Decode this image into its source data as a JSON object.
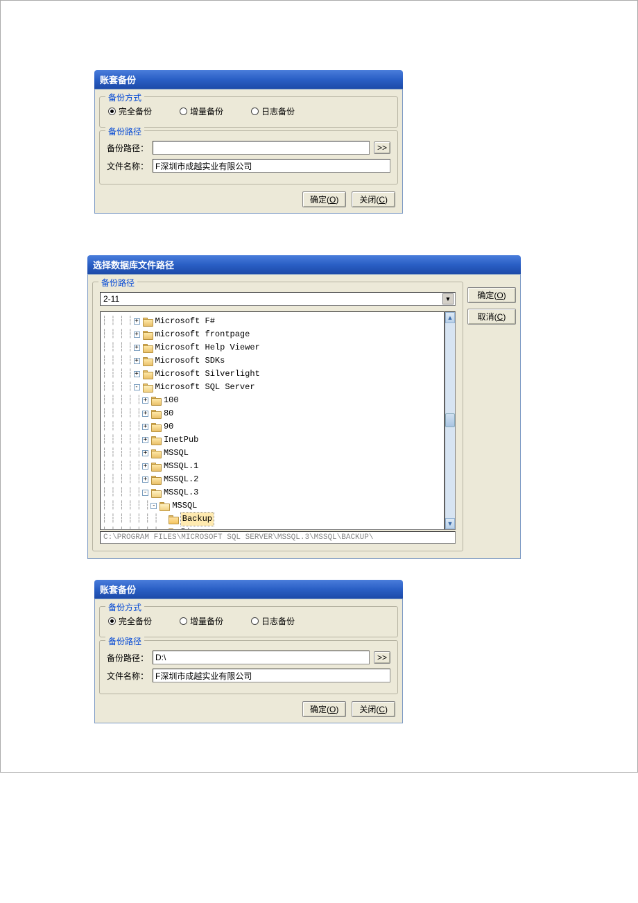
{
  "dialog1": {
    "title": "账套备份",
    "mode_group_label": "备份方式",
    "radios": {
      "full": "完全备份",
      "incr": "增量备份",
      "log": "日志备份",
      "selected": "full"
    },
    "path_group_label": "备份路径",
    "path_label": "备份路径：",
    "path_value": "",
    "browse_label": ">>",
    "file_label": "文件名称：",
    "file_value": "F深圳市成越实业有限公司",
    "ok_label": "确定(O)",
    "close_label": "关闭(C)"
  },
  "dialog2": {
    "title": "选择数据库文件路径",
    "group_label": "备份路径",
    "combo_value": "2-11",
    "ok_label": "确定(O)",
    "cancel_label": "取消(C)",
    "path_value": "C:\\PROGRAM FILES\\MICROSOFT SQL SERVER\\MSSQL.3\\MSSQL\\BACKUP\\",
    "tree": [
      {
        "indent": 4,
        "expander": "+",
        "open": false,
        "label": "Microsoft F#"
      },
      {
        "indent": 4,
        "expander": "+",
        "open": false,
        "label": "microsoft frontpage"
      },
      {
        "indent": 4,
        "expander": "+",
        "open": false,
        "label": "Microsoft Help Viewer"
      },
      {
        "indent": 4,
        "expander": "+",
        "open": false,
        "label": "Microsoft SDKs"
      },
      {
        "indent": 4,
        "expander": "+",
        "open": false,
        "label": "Microsoft Silverlight"
      },
      {
        "indent": 4,
        "expander": "-",
        "open": true,
        "label": "Microsoft SQL Server"
      },
      {
        "indent": 5,
        "expander": "+",
        "open": false,
        "label": "100"
      },
      {
        "indent": 5,
        "expander": "+",
        "open": false,
        "label": "80"
      },
      {
        "indent": 5,
        "expander": "+",
        "open": false,
        "label": "90"
      },
      {
        "indent": 5,
        "expander": "+",
        "open": false,
        "label": "InetPub"
      },
      {
        "indent": 5,
        "expander": "+",
        "open": false,
        "label": "MSSQL"
      },
      {
        "indent": 5,
        "expander": "+",
        "open": false,
        "label": "MSSQL.1"
      },
      {
        "indent": 5,
        "expander": "+",
        "open": false,
        "label": "MSSQL.2"
      },
      {
        "indent": 5,
        "expander": "-",
        "open": true,
        "label": "MSSQL.3"
      },
      {
        "indent": 6,
        "expander": "-",
        "open": true,
        "label": "MSSQL"
      },
      {
        "indent": 7,
        "expander": "",
        "open": false,
        "label": "Backup",
        "selected": true
      },
      {
        "indent": 7,
        "expander": "+",
        "open": false,
        "label": "Binn"
      }
    ]
  },
  "dialog3": {
    "title": "账套备份",
    "mode_group_label": "备份方式",
    "radios": {
      "full": "完全备份",
      "incr": "增量备份",
      "log": "日志备份",
      "selected": "full"
    },
    "path_group_label": "备份路径",
    "path_label": "备份路径：",
    "path_value": "D:\\",
    "browse_label": ">>",
    "file_label": "文件名称：",
    "file_value": "F深圳市成越实业有限公司",
    "ok_label": "确定(O)",
    "close_label": "关闭(C)"
  }
}
